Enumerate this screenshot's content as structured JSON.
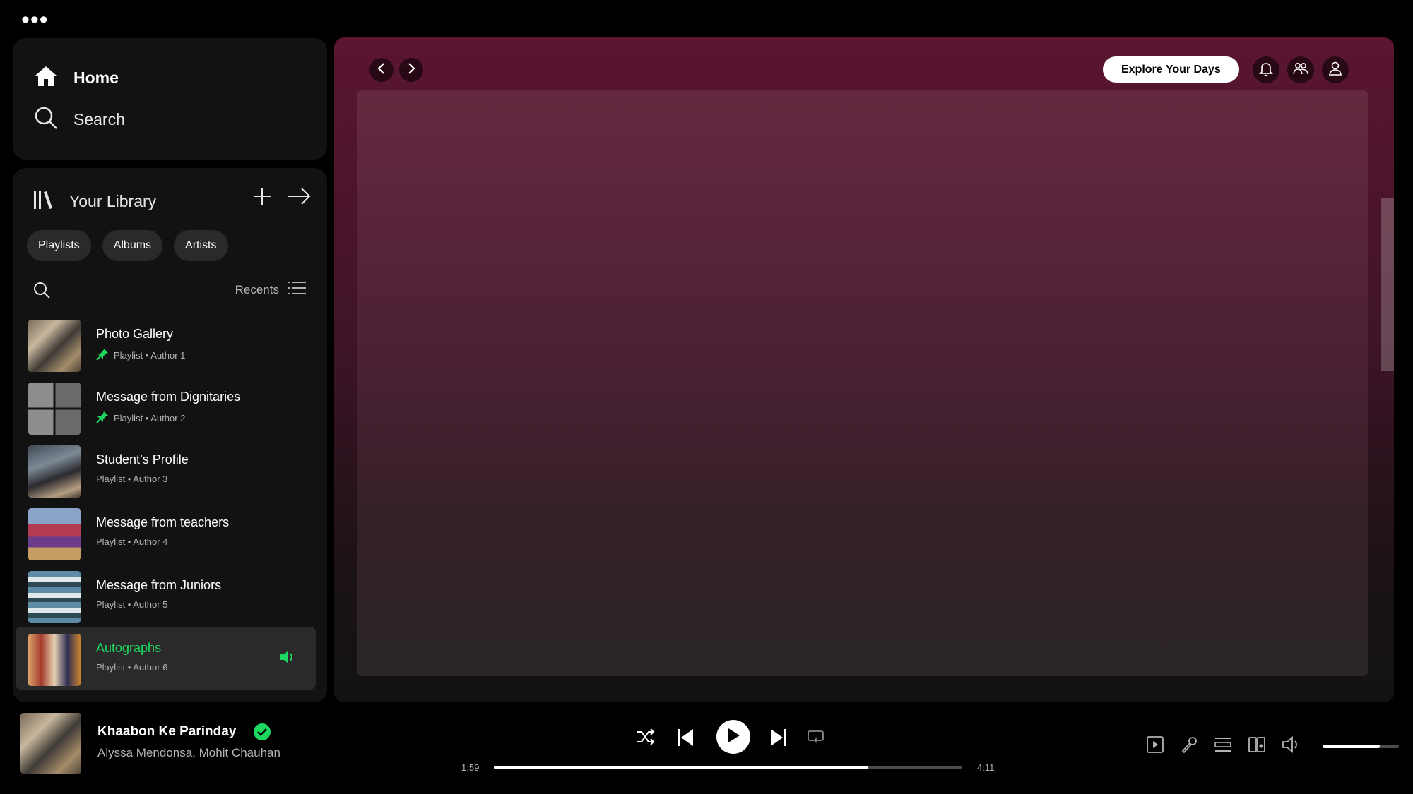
{
  "window": {
    "menu_dots": "•••"
  },
  "nav": {
    "home_label": "Home",
    "search_label": "Search"
  },
  "library": {
    "title": "Your Library",
    "chips": [
      "Playlists",
      "Albums",
      "Artists"
    ],
    "sort_label": "Recents",
    "items": [
      {
        "title": "Photo Gallery",
        "subtitle": "Playlist • Author 1",
        "pinned": true,
        "thumb": "ph1"
      },
      {
        "title": "Message from Dignitaries",
        "subtitle": "Playlist • Author 2",
        "pinned": true,
        "thumb": "ph2"
      },
      {
        "title": "Student’s Profile",
        "subtitle": "Playlist • Author 3",
        "pinned": false,
        "thumb": "ph3"
      },
      {
        "title": "Message from teachers",
        "subtitle": "Playlist • Author 4",
        "pinned": false,
        "thumb": "ph4"
      },
      {
        "title": "Message from Juniors",
        "subtitle": "Playlist • Author 5",
        "pinned": false,
        "thumb": "ph5"
      },
      {
        "title": "Autographs",
        "subtitle": "Playlist • Author 6",
        "pinned": false,
        "thumb": "ph6",
        "playing": true
      }
    ]
  },
  "header": {
    "explore_label": "Explore Your Days"
  },
  "now_playing": {
    "title": "Khaabon Ke Parinday",
    "artists": "Alyssa Mendonsa, Mohit Chauhan",
    "elapsed": "1:59",
    "duration": "4:11",
    "progress": 0.8,
    "volume": 0.75
  },
  "colors": {
    "accent": "#1ed760",
    "main_gradient_top": "#5b1530",
    "panel": "#121212"
  }
}
